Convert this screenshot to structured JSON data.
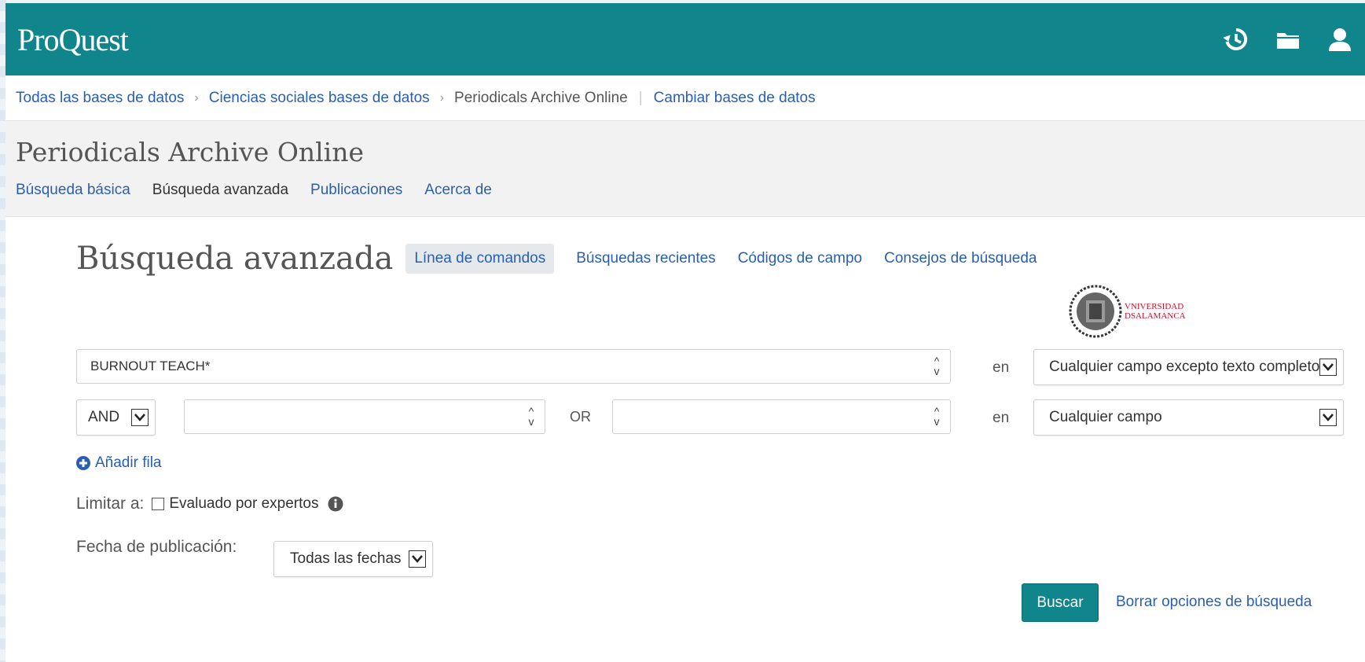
{
  "header": {
    "logo": "ProQuest",
    "colors": {
      "accent": "#10858c",
      "link": "#2a5fb0"
    }
  },
  "breadcrumb": {
    "items": [
      "Todas las bases de datos",
      "Ciencias sociales bases de datos",
      "Periodicals Archive Online"
    ],
    "change_db": "Cambiar bases de datos"
  },
  "database": {
    "title": "Periodicals Archive Online",
    "nav": [
      "Búsqueda básica",
      "Búsqueda avanzada",
      "Publicaciones",
      "Acerca de"
    ]
  },
  "advanced": {
    "title": "Búsqueda avanzada",
    "links": [
      "Línea de comandos",
      "Búsquedas recientes",
      "Códigos de campo",
      "Consejos de búsqueda"
    ],
    "university_logo": [
      "VNIVERSIDAD",
      "DSALAMANCA"
    ]
  },
  "search": {
    "row1": {
      "value": "BURNOUT TEACH*",
      "in_label": "en",
      "field": "Cualquier campo excepto texto completo"
    },
    "row2": {
      "operator": "AND",
      "value_a": "",
      "or_label": "OR",
      "value_b": "",
      "in_label": "en",
      "field": "Cualquier campo"
    },
    "add_row": "Añadir fila"
  },
  "limits": {
    "label": "Limitar a:",
    "peer_reviewed": "Evaluado por expertos",
    "peer_reviewed_checked": false
  },
  "date": {
    "label": "Fecha de publicación:",
    "value": "Todas las fechas"
  },
  "actions": {
    "search": "Buscar",
    "clear": "Borrar opciones de búsqueda"
  }
}
